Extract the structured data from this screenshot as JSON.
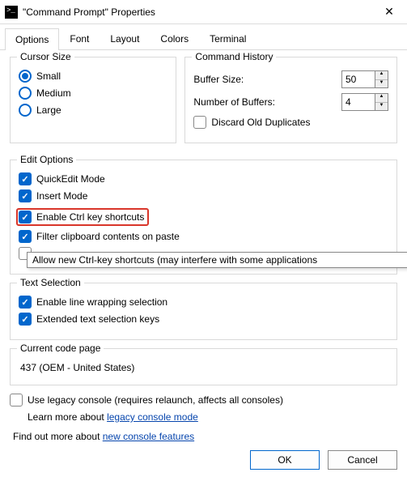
{
  "title": "\"Command Prompt\" Properties",
  "tabs": {
    "t0": "Options",
    "t1": "Font",
    "t2": "Layout",
    "t3": "Colors",
    "t4": "Terminal"
  },
  "cursor": {
    "legend": "Cursor Size",
    "small": "Small",
    "medium": "Medium",
    "large": "Large"
  },
  "history": {
    "legend": "Command History",
    "buffer_label": "Buffer Size:",
    "buffer_value": "50",
    "numbuf_label": "Number of Buffers:",
    "numbuf_value": "4",
    "discard": "Discard Old Duplicates"
  },
  "edit": {
    "legend": "Edit Options",
    "quickedit": "QuickEdit Mode",
    "insert": "Insert Mode",
    "ctrlkey": "Enable Ctrl key shortcuts",
    "filter": "Filter clipboard contents on paste",
    "ctrlcv_partial": ""
  },
  "tooltip": "Allow new Ctrl-key shortcuts (may interfere with some applications",
  "textsel": {
    "legend": "Text Selection",
    "linewrap": "Enable line wrapping selection",
    "extended": "Extended text selection keys"
  },
  "codepage": {
    "legend": "Current code page",
    "value": "437  (OEM - United States)"
  },
  "legacy": {
    "label": "Use legacy console (requires relaunch, affects all consoles)",
    "learn_pre": "Learn more about ",
    "learn_link": "legacy console mode"
  },
  "findout": {
    "pre": "Find out more about ",
    "link": "new console features"
  },
  "buttons": {
    "ok": "OK",
    "cancel": "Cancel"
  }
}
